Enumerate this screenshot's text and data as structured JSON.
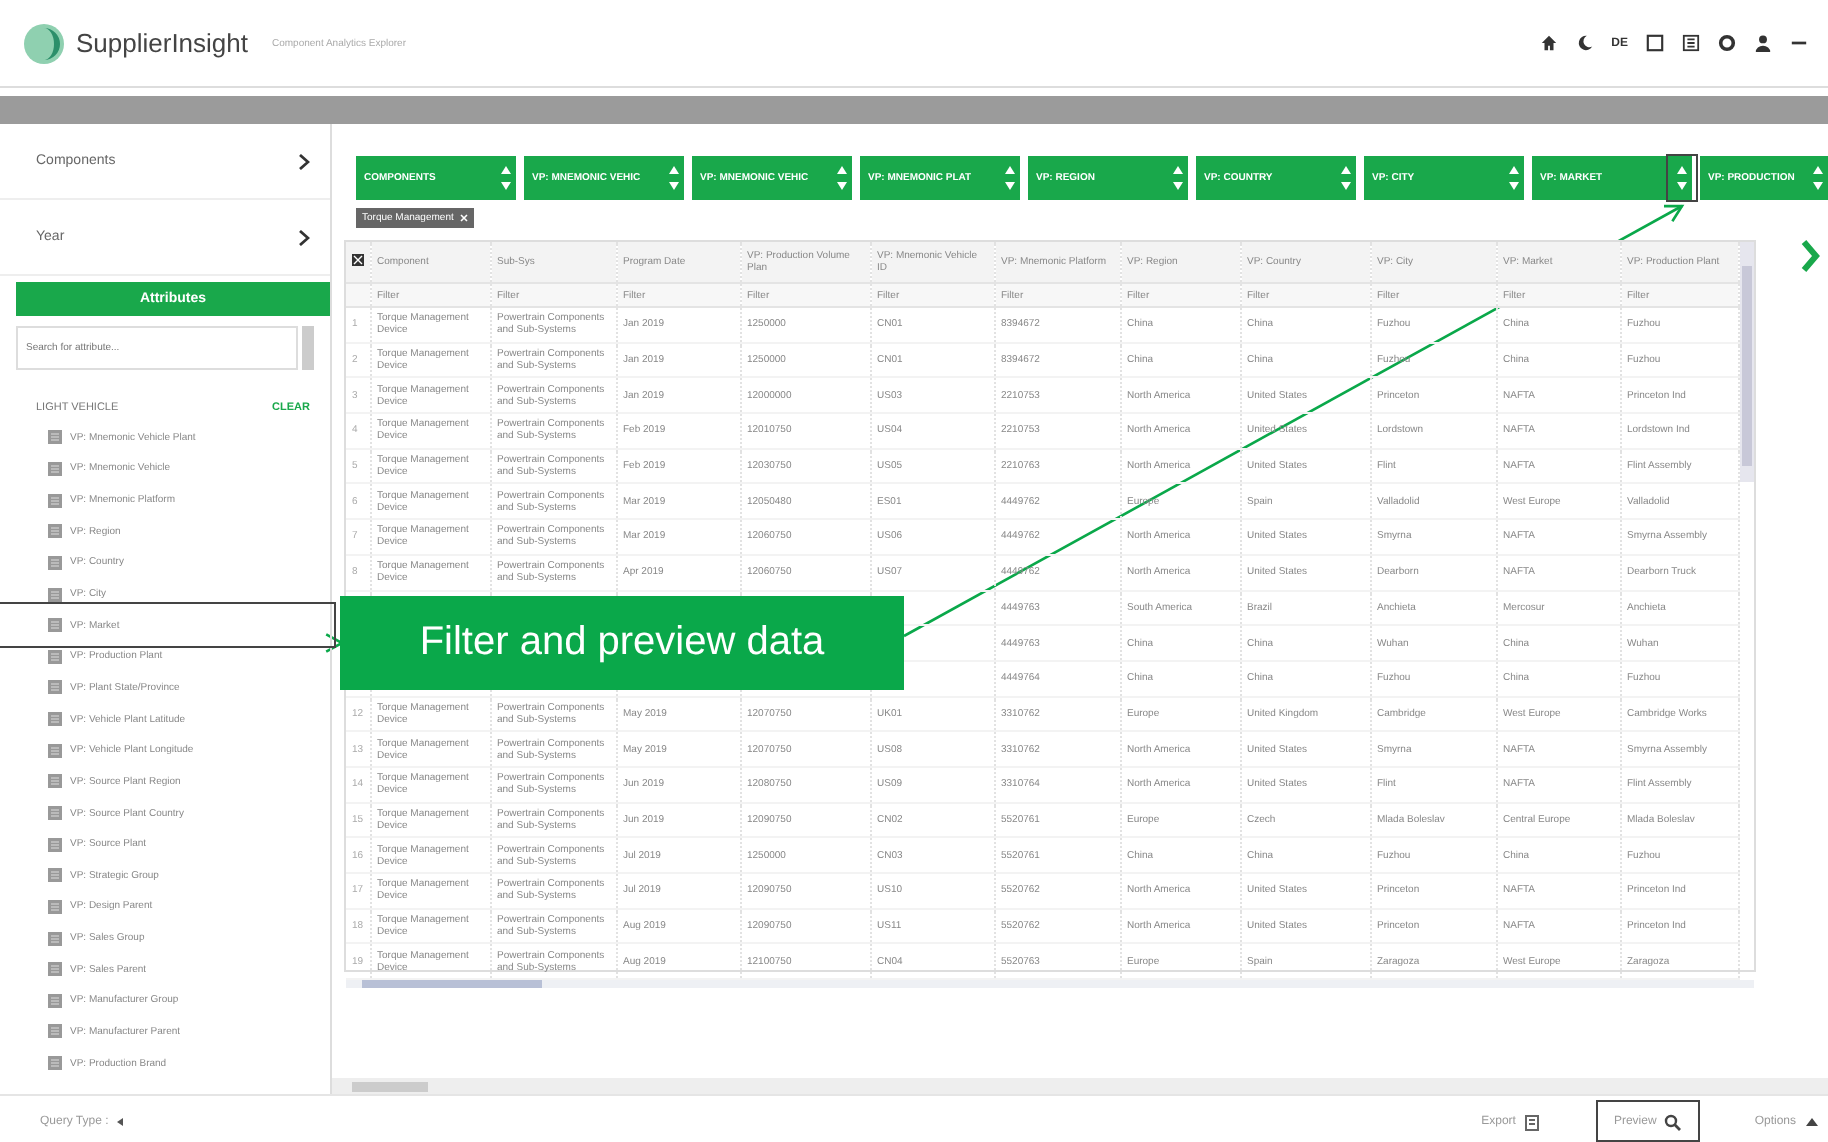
{
  "app": {
    "name": "SupplierInsight",
    "subtitle": "Component Analytics Explorer",
    "language": "DE"
  },
  "sidebar": {
    "sections": [
      "Components",
      "Year"
    ],
    "attributes_title": "Attributes",
    "search_placeholder": "Search for attribute...",
    "group": "LIGHT VEHICLE",
    "clear": "CLEAR",
    "items": [
      {
        "label": "VP: Mnemonic Vehicle Plant"
      },
      {
        "label": "VP: Mnemonic Vehicle"
      },
      {
        "label": "VP: Mnemonic Platform"
      },
      {
        "label": "VP: Region"
      },
      {
        "label": "VP: Country"
      },
      {
        "label": "VP: City"
      },
      {
        "label": "VP: Market",
        "framed": true
      },
      {
        "label": "VP: Production Plant"
      },
      {
        "label": "VP: Plant State/Province"
      },
      {
        "label": "VP: Vehicle Plant Latitude"
      },
      {
        "label": "VP: Vehicle Plant Longitude"
      },
      {
        "label": "VP: Source Plant Region"
      },
      {
        "label": "VP: Source Plant Country"
      },
      {
        "label": "VP: Source Plant"
      },
      {
        "label": "VP: Strategic Group"
      },
      {
        "label": "VP: Design Parent"
      },
      {
        "label": "VP: Sales Group"
      },
      {
        "label": "VP: Sales Parent"
      },
      {
        "label": "VP: Manufacturer Group"
      },
      {
        "label": "VP: Manufacturer Parent"
      },
      {
        "label": "VP: Production Brand"
      }
    ]
  },
  "pivot_fields": [
    {
      "label": "COMPONENTS"
    },
    {
      "label": "VP: MNEMONIC VEHIC"
    },
    {
      "label": "VP: MNEMONIC VEHIC"
    },
    {
      "label": "VP: MNEMONIC PLAT"
    },
    {
      "label": "VP: REGION"
    },
    {
      "label": "VP: COUNTRY"
    },
    {
      "label": "VP: CITY"
    },
    {
      "label": "VP: MARKET",
      "framed": true
    },
    {
      "label": "VP: PRODUCTION"
    }
  ],
  "filter_chips": [
    "Torque Management"
  ],
  "table": {
    "columns": [
      {
        "label": "Component",
        "filter": "Filter"
      },
      {
        "label": "Sub-Sys",
        "filter": "Filter"
      },
      {
        "label": "Program Date",
        "filter": "Filter"
      },
      {
        "label": "VP: Production Volume Plan",
        "filter": "Filter"
      },
      {
        "label": "VP: Mnemonic Vehicle ID",
        "filter": "Filter"
      },
      {
        "label": "VP: Mnemonic Platform",
        "filter": "Filter"
      },
      {
        "label": "VP: Region",
        "filter": "Filter"
      },
      {
        "label": "VP: Country",
        "filter": "Filter"
      },
      {
        "label": "VP: City",
        "filter": "Filter"
      },
      {
        "label": "VP: Market",
        "filter": "Filter"
      },
      {
        "label": "VP: Production Plant",
        "filter": "Filter"
      }
    ],
    "rows": [
      {
        "number": "1",
        "cells": [
          "Torque Management Device",
          "Powertrain Components and Sub-Systems",
          "Jan 2019",
          "1250000",
          "CN01",
          "8394672",
          "China",
          "China",
          "Fuzhou",
          "China",
          "Fuzhou"
        ]
      },
      {
        "number": "2",
        "cells": [
          "Torque Management Device",
          "Powertrain Components and Sub-Systems",
          "Jan 2019",
          "1250000",
          "CN01",
          "8394672",
          "China",
          "China",
          "Fuzhou",
          "China",
          "Fuzhou"
        ]
      },
      {
        "number": "3",
        "cells": [
          "Torque Management Device",
          "Powertrain Components and Sub-Systems",
          "Jan 2019",
          "12000000",
          "US03",
          "2210753",
          "North America",
          "United States",
          "Princeton",
          "NAFTA",
          "Princeton Ind"
        ]
      },
      {
        "number": "4",
        "cells": [
          "Torque Management Device",
          "Powertrain Components and Sub-Systems",
          "Feb 2019",
          "12010750",
          "US04",
          "2210753",
          "North America",
          "United States",
          "Lordstown",
          "NAFTA",
          "Lordstown Ind"
        ]
      },
      {
        "number": "5",
        "cells": [
          "Torque Management Device",
          "Powertrain Components and Sub-Systems",
          "Feb 2019",
          "12030750",
          "US05",
          "2210763",
          "North America",
          "United States",
          "Flint",
          "NAFTA",
          "Flint Assembly"
        ]
      },
      {
        "number": "6",
        "cells": [
          "Torque Management Device",
          "Powertrain Components and Sub-Systems",
          "Mar 2019",
          "12050480",
          "ES01",
          "4449762",
          "Europe",
          "Spain",
          "Valladolid",
          "West Europe",
          "Valladolid"
        ]
      },
      {
        "number": "7",
        "cells": [
          "Torque Management Device",
          "Powertrain Components and Sub-Systems",
          "Mar 2019",
          "12060750",
          "US06",
          "4449762",
          "North America",
          "United States",
          "Smyrna",
          "NAFTA",
          "Smyrna Assembly"
        ]
      },
      {
        "number": "8",
        "cells": [
          "Torque Management Device",
          "Powertrain Components and Sub-Systems",
          "Apr 2019",
          "12060750",
          "US07",
          "4449762",
          "North America",
          "United States",
          "Dearborn",
          "NAFTA",
          "Dearborn Truck"
        ]
      },
      {
        "cells": [
          null,
          null,
          null,
          null,
          null,
          "4449763",
          "South America",
          "Brazil",
          "Anchieta",
          "Mercosur",
          "Anchieta"
        ]
      },
      {
        "cells": [
          null,
          null,
          null,
          null,
          null,
          "4449763",
          "China",
          "China",
          "Wuhan",
          "China",
          "Wuhan"
        ]
      },
      {
        "cells": [
          null,
          null,
          null,
          null,
          null,
          "4449764",
          "China",
          "China",
          "Fuzhou",
          "China",
          "Fuzhou"
        ]
      },
      {
        "number": "12",
        "cells": [
          "Torque Management Device",
          "Powertrain Components and Sub-Systems",
          "May 2019",
          "12070750",
          "UK01",
          "3310762",
          "Europe",
          "United Kingdom",
          "Cambridge",
          "West Europe",
          "Cambridge Works"
        ]
      },
      {
        "number": "13",
        "cells": [
          "Torque Management Device",
          "Powertrain Components and Sub-Systems",
          "May 2019",
          "12070750",
          "US08",
          "3310762",
          "North America",
          "United States",
          "Smyrna",
          "NAFTA",
          "Smyrna Assembly"
        ]
      },
      {
        "number": "14",
        "cells": [
          "Torque Management Device",
          "Powertrain Components and Sub-Systems",
          "Jun 2019",
          "12080750",
          "US09",
          "3310764",
          "North America",
          "United States",
          "Flint",
          "NAFTA",
          "Flint Assembly"
        ]
      },
      {
        "number": "15",
        "cells": [
          "Torque Management Device",
          "Powertrain Components and Sub-Systems",
          "Jun 2019",
          "12090750",
          "CN02",
          "5520761",
          "Europe",
          "Czech",
          "Mlada Boleslav",
          "Central Europe",
          "Mlada Boleslav"
        ]
      },
      {
        "number": "16",
        "cells": [
          "Torque Management Device",
          "Powertrain Components and Sub-Systems",
          "Jul 2019",
          "1250000",
          "CN03",
          "5520761",
          "China",
          "China",
          "Fuzhou",
          "China",
          "Fuzhou"
        ]
      },
      {
        "number": "17",
        "cells": [
          "Torque Management Device",
          "Powertrain Components and Sub-Systems",
          "Jul 2019",
          "12090750",
          "US10",
          "5520762",
          "North America",
          "United States",
          "Princeton",
          "NAFTA",
          "Princeton Ind"
        ]
      },
      {
        "number": "18",
        "cells": [
          "Torque Management Device",
          "Powertrain Components and Sub-Systems",
          "Aug 2019",
          "12090750",
          "US11",
          "5520762",
          "North America",
          "United States",
          "Princeton",
          "NAFTA",
          "Princeton Ind"
        ]
      },
      {
        "number": "19",
        "cells": [
          "Torque Management Device",
          "Powertrain Components and Sub-Systems",
          "Aug 2019",
          "12100750",
          "CN04",
          "5520763",
          "Europe",
          "Spain",
          "Zaragoza",
          "West Europe",
          "Zaragoza"
        ]
      }
    ]
  },
  "callout": "Filter and preview data",
  "footer": {
    "query_type": "Query Type :",
    "actions": [
      {
        "label": "Export",
        "kind": "export"
      },
      {
        "label": "Preview",
        "kind": "preview",
        "framed": true
      },
      {
        "label": "Options",
        "kind": "options"
      }
    ]
  }
}
